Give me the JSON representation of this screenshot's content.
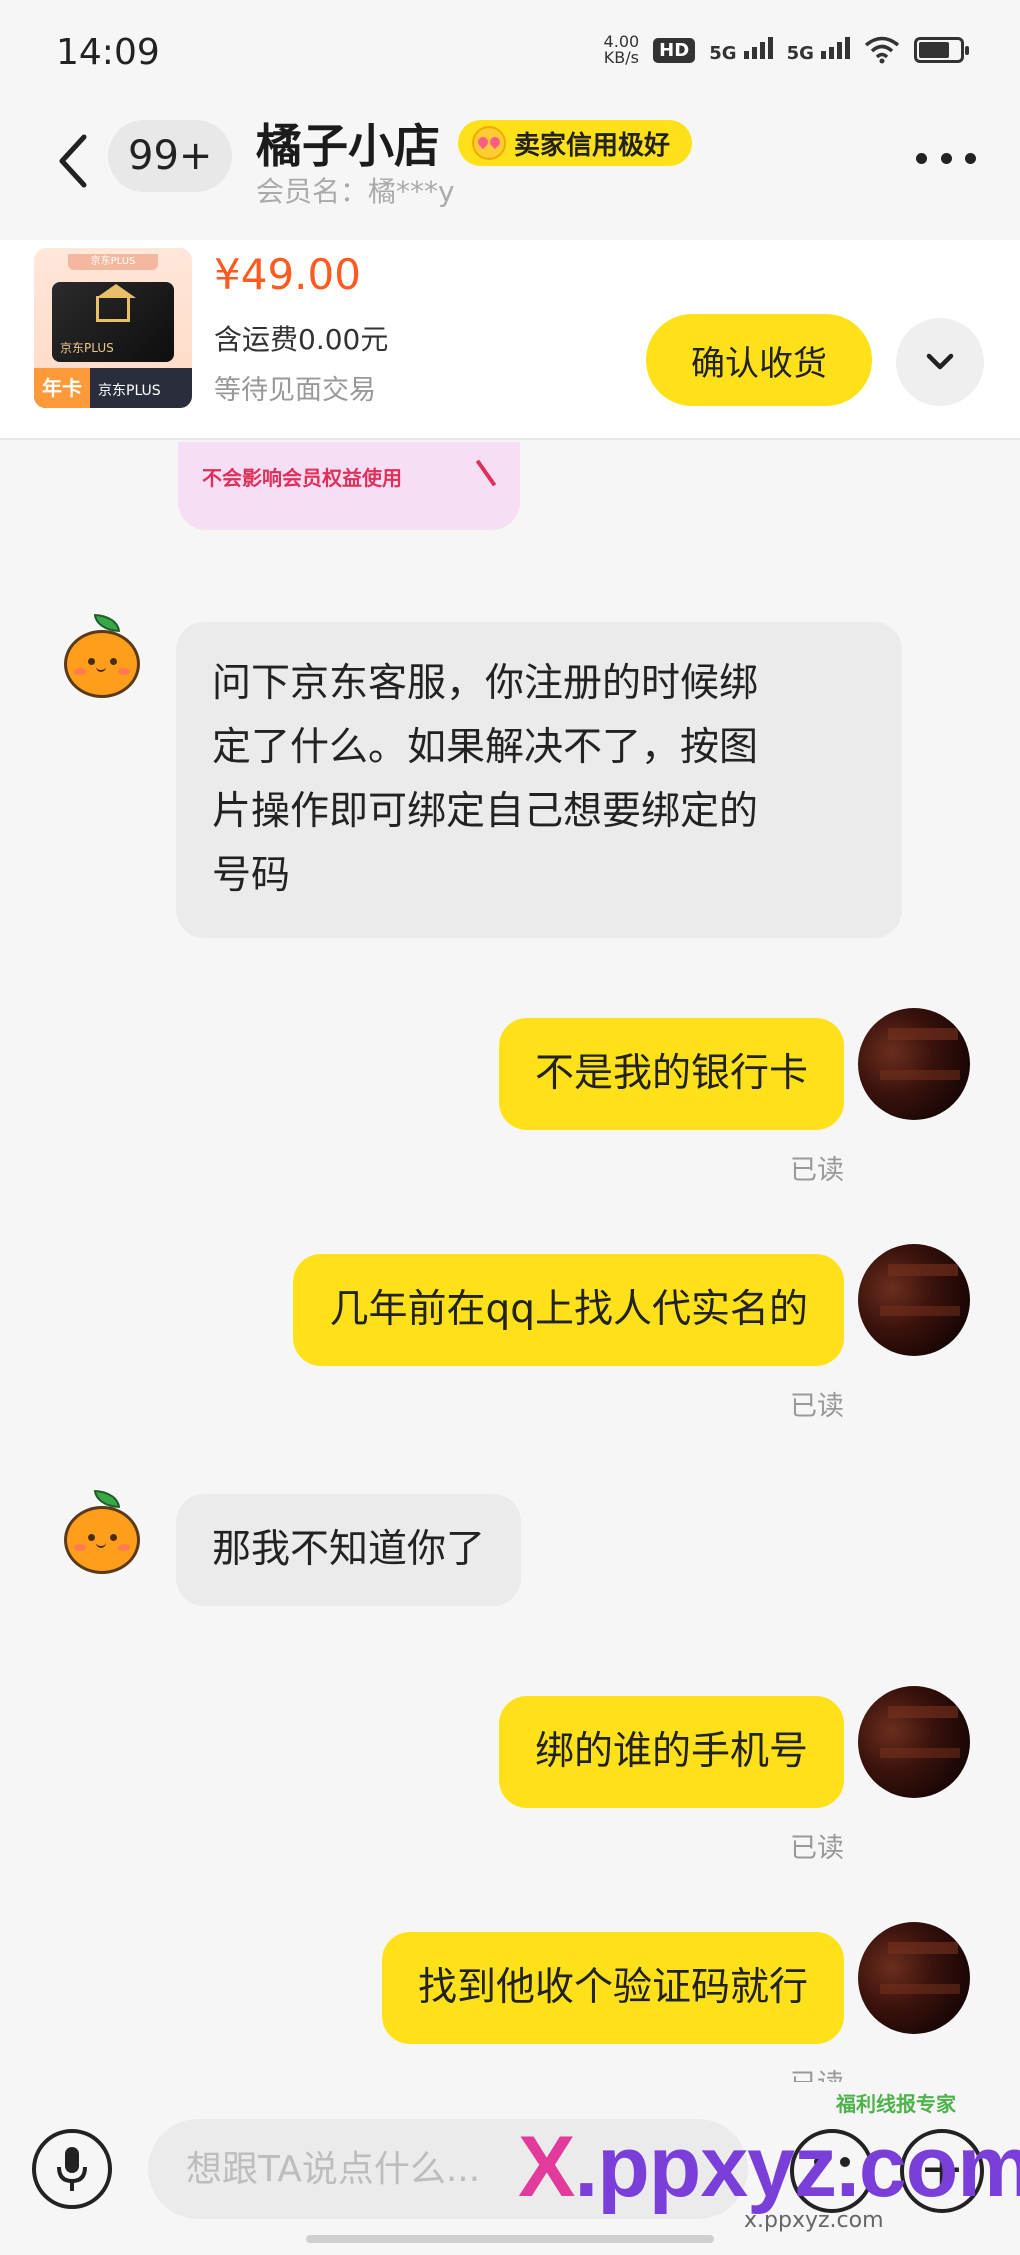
{
  "status_bar": {
    "time": "14:09",
    "net_speed_value": "4.00",
    "net_speed_unit": "KB/s",
    "hd_label": "HD",
    "sim1": "5G",
    "sim2": "5G"
  },
  "header": {
    "unread_count": "99+",
    "shop_name": "橘子小店",
    "credit_badge": "卖家信用极好",
    "member_name": "会员名：橘***y"
  },
  "product": {
    "thumb_top_text": "京东PLUS",
    "thumb_card_label": "京东PLUS",
    "thumb_year": "年卡",
    "thumb_bottom_text": "京东PLUS",
    "price": "¥49.00",
    "shipping": "含运费0.00元",
    "status": "等待见面交易",
    "confirm_label": "确认收货"
  },
  "prev_image_text": "不会影响会员权益使用",
  "messages": [
    {
      "from": "seller",
      "text_lines": [
        "问下京东客服，你注册的时候绑",
        "定了什么。如果解决不了，按图",
        "片操作即可绑定自己想要绑定的",
        "号码"
      ]
    },
    {
      "from": "me",
      "text": "不是我的银行卡",
      "read": "已读"
    },
    {
      "from": "me",
      "text": "几年前在qq上找人代实名的",
      "read": "已读"
    },
    {
      "from": "seller",
      "text": "那我不知道你了"
    },
    {
      "from": "me",
      "text": "绑的谁的手机号",
      "read": "已读"
    },
    {
      "from": "me",
      "text": "找到他收个验证码就行",
      "read": "已读"
    }
  ],
  "input": {
    "placeholder": "想跟TA说点什么..."
  },
  "watermark": {
    "x": "X",
    "rest": ".ppxyz.com",
    "sub": "x.ppxyz.com",
    "badge": "福利线报专家"
  },
  "colors": {
    "accent_yellow": "#ffe11a",
    "price_orange": "#ff5a1f",
    "incoming_bubble": "#ebebeb"
  },
  "icons": [
    "back-chevron-icon",
    "more-dots-icon",
    "chevron-down-icon",
    "microphone-icon",
    "emoji-icon",
    "plus-icon"
  ]
}
